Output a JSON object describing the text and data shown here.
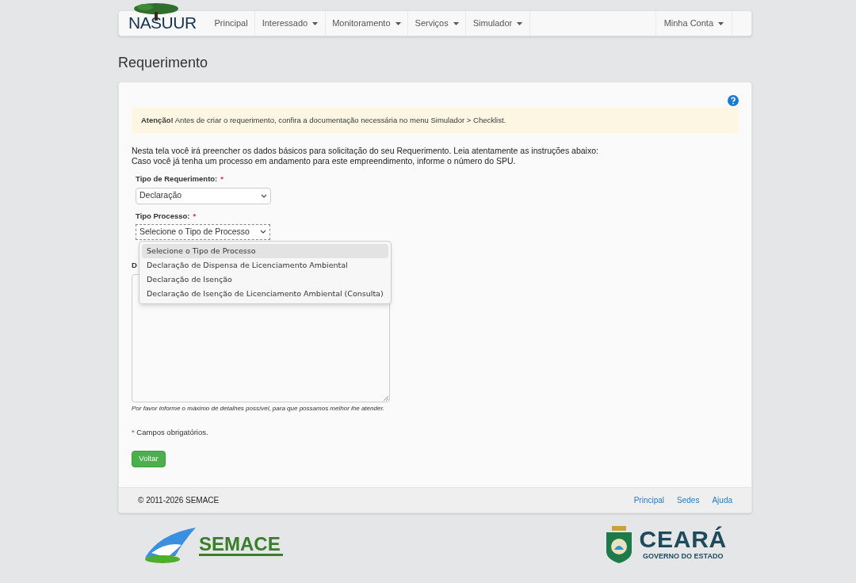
{
  "navbar": {
    "brand": "NASUUR",
    "items": [
      {
        "label": "Principal",
        "dropdown": false
      },
      {
        "label": "Interessado",
        "dropdown": true
      },
      {
        "label": "Monitoramento",
        "dropdown": true
      },
      {
        "label": "Serviços",
        "dropdown": true
      },
      {
        "label": "Simulador",
        "dropdown": true
      }
    ],
    "account": {
      "label": "Minha Conta",
      "dropdown": true
    }
  },
  "page_title": "Requerimento",
  "alert": {
    "strong": "Atenção!",
    "text": "Antes de criar o requerimento, confira a documentação necessária no menu Simulador > Checklist."
  },
  "intro": [
    "Nesta tela você irá preencher os dados básicos para solicitação do seu Requerimento. Leia atentamente as instruções abaixo:",
    "Caso você já tenha um processo em andamento para este empreendimento, informe o número do SPU."
  ],
  "fields": [
    {
      "label": "Tipo de Requerimento:",
      "required": true,
      "value": "Declaração"
    },
    {
      "label": "Tipo Processo:",
      "required": true,
      "value": "Selecione o Tipo de Processo",
      "expanded": true
    }
  ],
  "dropdown_options": [
    {
      "label": "Selecione o Tipo de Processo",
      "selected": true
    },
    {
      "label": "Declaração de Dispensa de Licenciamento Ambiental",
      "selected": false
    },
    {
      "label": "Declaração de Isenção",
      "selected": false
    },
    {
      "label": "Declaração de Isenção de Licenciamento Ambiental (Consulta)",
      "selected": false
    }
  ],
  "textarea": {
    "label": "D",
    "help": "Por favor informe o máximo de detalhes possível, para que possamos melhor lhe atender."
  },
  "required_note": {
    "mark": "*",
    "text": "Campos obrigatórios."
  },
  "back_button": "Voltar",
  "footer": {
    "copyright": "© 2011-2026 SEMACE",
    "links": [
      "Principal",
      "Sedes",
      "Ajuda"
    ]
  },
  "logos": {
    "left": "SEMACE",
    "right_title": "CEARÁ",
    "right_subtitle": "GOVERNO DO ESTADO"
  }
}
